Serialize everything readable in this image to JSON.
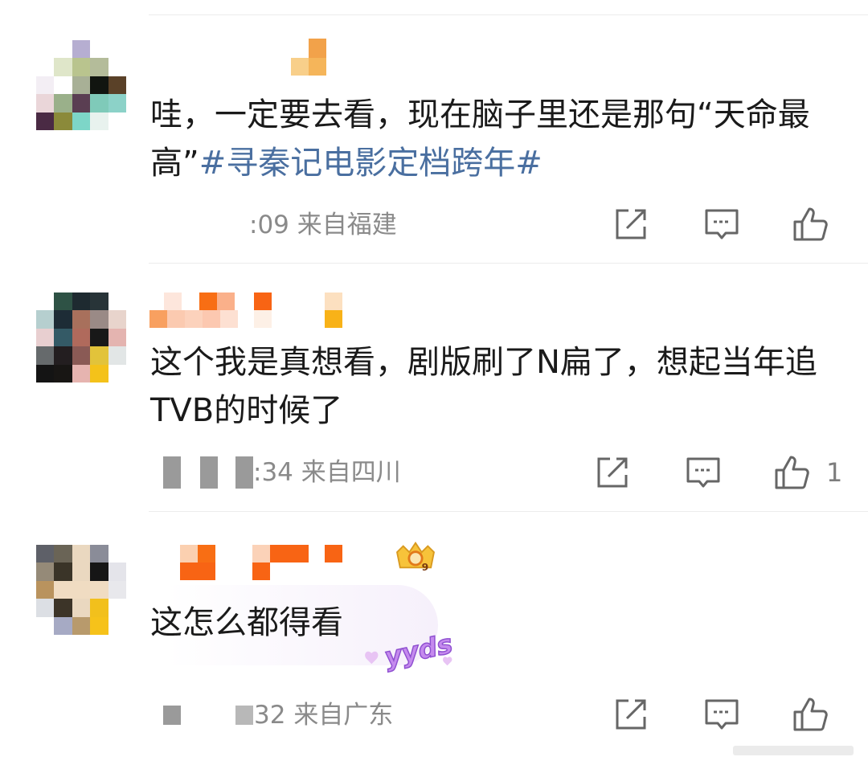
{
  "comments": [
    {
      "text_plain": "哇，一定要去看，现在脑子里还是那句“天命最高”",
      "hashtag": "#寻秦记电影定档跨年#",
      "time_suffix": ":09",
      "location": "来自福建",
      "likes": ""
    },
    {
      "text_plain": "这个我是真想看，剧版刷了N扁了，想起当年追TVB的时候了",
      "hashtag": "",
      "time_suffix": ":34",
      "location": "来自四川",
      "likes": "1"
    },
    {
      "text_plain": "这怎么都得看",
      "hashtag": "",
      "time_suffix": "32",
      "location": "来自广东",
      "likes": "",
      "sticker_text": "yyds",
      "badge_level": "9"
    }
  ],
  "icons": {
    "share": "share-icon",
    "reply": "comment-icon",
    "like": "thumbs-up-icon"
  },
  "colors": {
    "hashtag": "#4a6fa0",
    "username_orange": "#f26a10",
    "meta_gray": "#8a8a8a"
  }
}
